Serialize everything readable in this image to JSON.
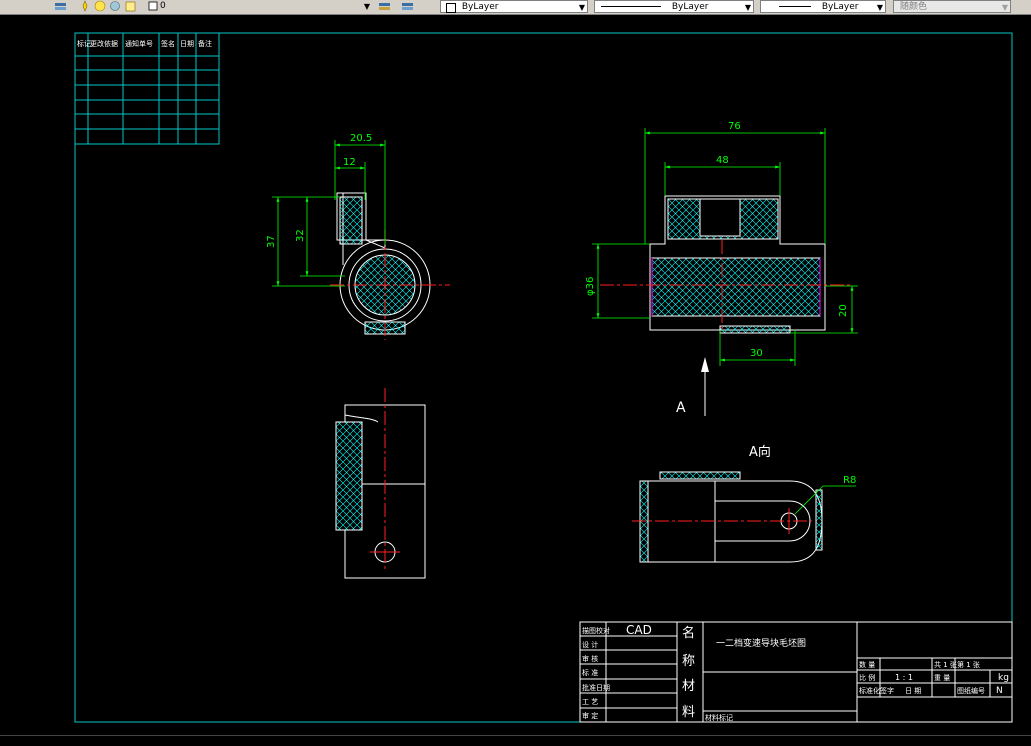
{
  "toolbar": {
    "layer_name": "0",
    "color_value": "ByLayer",
    "linetype_value": "ByLayer",
    "lineweight_value": "ByLayer",
    "plotstyle_value": "随颜色"
  },
  "drawing": {
    "history_table": {
      "headers": [
        "标记",
        "更改依据",
        "通知单号",
        "签名",
        "日期",
        "备注"
      ]
    },
    "dimensions": {
      "width_76": "76",
      "width_48": "48",
      "width_20_5": "20.5",
      "width_12": "12",
      "height_37": "37",
      "height_32": "32",
      "diameter_36": "φ36",
      "height_20": "20",
      "width_30": "30",
      "radius_r8": "R8"
    },
    "view_labels": {
      "arrow_label": "A",
      "view_a": "A向"
    },
    "title_block": {
      "cad_text": "CAD",
      "part_title": "一二档变速导块毛坯图",
      "name_label": [
        "名",
        "称"
      ],
      "material_label": [
        "材",
        "料"
      ],
      "left_labels": [
        "描图校对",
        "设 计",
        "审 核",
        "标 准",
        "批准日期",
        "工 艺",
        "审 定"
      ],
      "material_note": "材料标记",
      "row1": [
        "数 量",
        "共 1 张",
        "第 1 张"
      ],
      "scale_label": "比 例",
      "scale_value": "1 : 1",
      "weight_label": "重 量",
      "weight_unit": "kg",
      "row3": [
        "标准化签字",
        "日 期",
        "图纸编号"
      ],
      "sheet_mark": "N"
    }
  }
}
